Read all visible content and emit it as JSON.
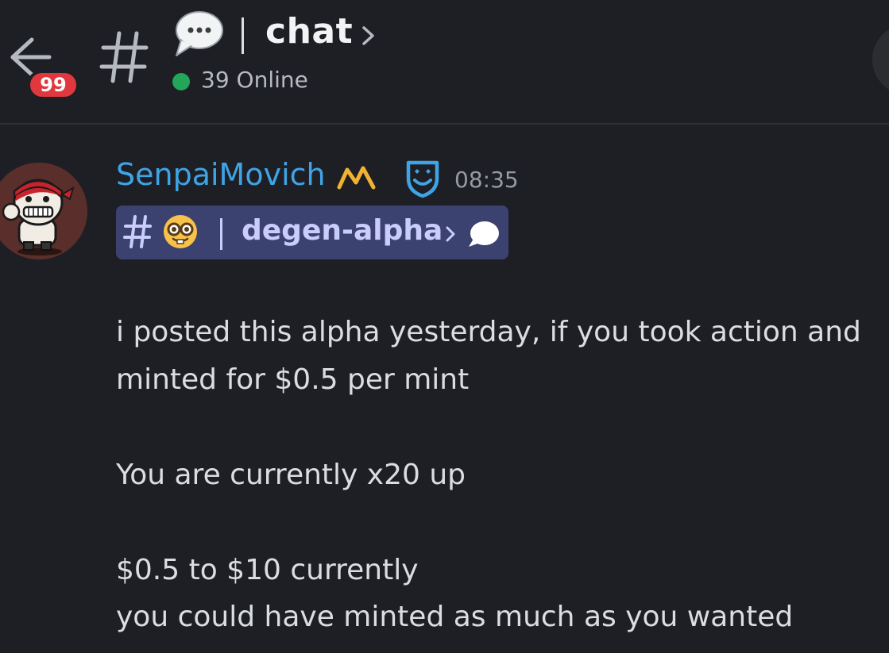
{
  "header": {
    "unread_count": "99",
    "channel_name": "chat",
    "online_status": "39 Online"
  },
  "message": {
    "author": "SenpaiMovich",
    "timestamp": "08:35",
    "channel_mention": {
      "name": "degen-alpha"
    },
    "lines": [
      "i posted this alpha yesterday, if you took action and",
      "minted for $0.5 per mint",
      "You are currently x20 up",
      "$0.5 to $10 currently",
      "you could have minted as much as you wanted"
    ]
  },
  "colors": {
    "background": "#1e1f24",
    "username": "#3ea4e6",
    "badge": "#e0383e",
    "online": "#23a55a",
    "mention_bg": "#3c4270",
    "mention_text": "#c9cdfb",
    "crown": "#f0b232"
  },
  "icons": {
    "back": "back-arrow-icon",
    "channel": "hash-icon",
    "channel_emoji": "speech-bubble-icon",
    "role_badge": "crown-icon",
    "mod_badge": "mod-shield-icon",
    "mention_emoji": "nerd-face-icon",
    "thread": "thread-bubble-icon"
  }
}
